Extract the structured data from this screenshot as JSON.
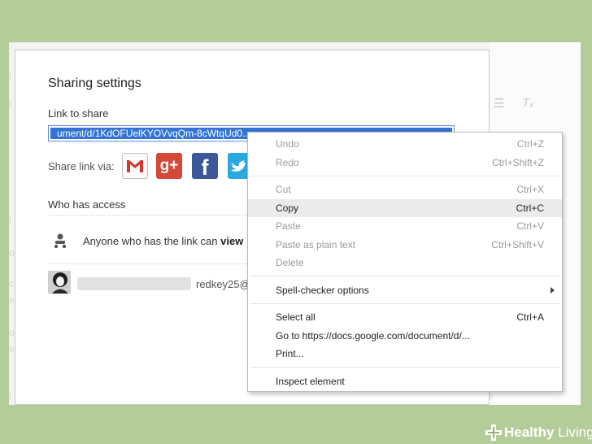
{
  "dialog": {
    "title": "Sharing settings",
    "link_label": "Link to share",
    "link_value": "ument/d/1KdOFUelKYOVvqQm-8cWtqUd0...",
    "share_via_label": "Share link via:",
    "social_icons": [
      "gmail-icon",
      "google-plus-icon",
      "facebook-icon",
      "twitter-icon"
    ],
    "gplus_glyph": "g+",
    "facebook_glyph": "f",
    "who_has_access_label": "Who has access",
    "anyone_text": "Anyone who has the link can ",
    "anyone_permission": "view",
    "user_email": "redkey25@"
  },
  "context_menu": {
    "groups": [
      [
        {
          "label": "Undo",
          "shortcut": "Ctrl+Z",
          "enabled": false
        },
        {
          "label": "Redo",
          "shortcut": "Ctrl+Shift+Z",
          "enabled": false
        }
      ],
      [
        {
          "label": "Cut",
          "shortcut": "Ctrl+X",
          "enabled": false
        },
        {
          "label": "Copy",
          "shortcut": "Ctrl+C",
          "enabled": true,
          "highlighted": true
        },
        {
          "label": "Paste",
          "shortcut": "Ctrl+V",
          "enabled": false
        },
        {
          "label": "Paste as plain text",
          "shortcut": "Ctrl+Shift+V",
          "enabled": false
        },
        {
          "label": "Delete",
          "shortcut": "",
          "enabled": false
        }
      ],
      [
        {
          "label": "Spell-checker options",
          "shortcut": "",
          "enabled": true,
          "submenu": true
        }
      ],
      [
        {
          "label": "Select all",
          "shortcut": "Ctrl+A",
          "enabled": true
        },
        {
          "label": "Go to https://docs.google.com/document/d/...",
          "shortcut": "",
          "enabled": true
        },
        {
          "label": "Print...",
          "shortcut": "",
          "enabled": true
        }
      ],
      [
        {
          "label": "Inspect element",
          "shortcut": "",
          "enabled": true
        }
      ]
    ]
  },
  "branding": {
    "bold": "Healthy",
    "light": " Living"
  },
  "colors": {
    "page_bg": "#b4cc9a",
    "selection": "#3373d4",
    "gmail_red": "#d33a2c",
    "gplus": "#d34836",
    "facebook": "#3b5998",
    "twitter": "#2aa9e0"
  }
}
